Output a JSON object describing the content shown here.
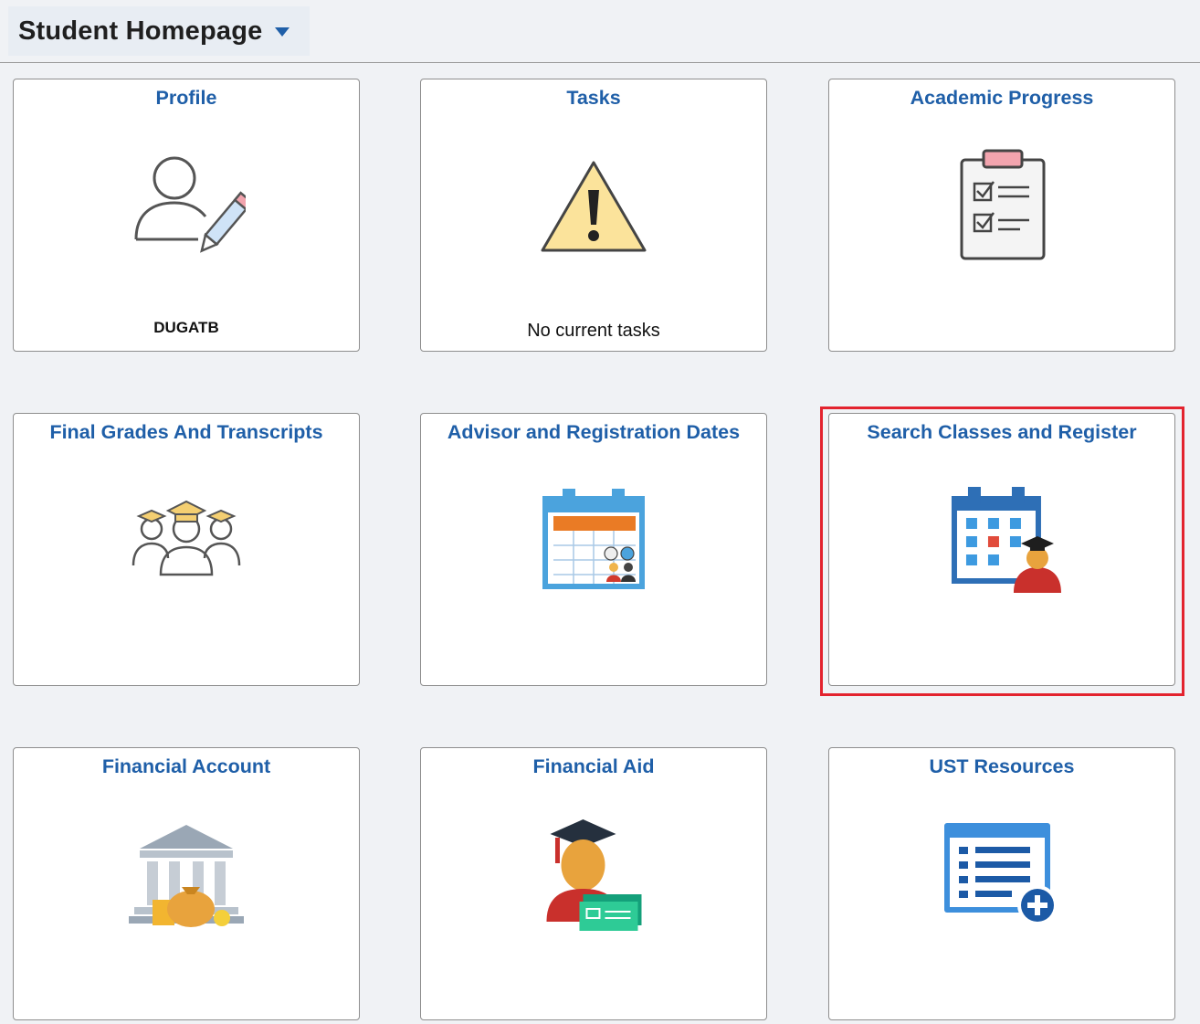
{
  "header": {
    "title": "Student Homepage"
  },
  "tiles": [
    {
      "title": "Profile",
      "subtitle": "DUGATB",
      "icon": "profile-edit-icon"
    },
    {
      "title": "Tasks",
      "subtitle": "No current tasks",
      "icon": "warning-icon"
    },
    {
      "title": "Academic Progress",
      "icon": "clipboard-checklist-icon"
    },
    {
      "title": "Final Grades And Transcripts",
      "icon": "graduates-group-icon"
    },
    {
      "title": "Advisor and Registration Dates",
      "icon": "calendar-advisor-icon"
    },
    {
      "title": "Search Classes and Register",
      "icon": "calendar-student-icon"
    },
    {
      "title": "Financial Account",
      "icon": "bank-money-icon"
    },
    {
      "title": "Financial Aid",
      "icon": "graduate-cash-icon"
    },
    {
      "title": "UST Resources",
      "icon": "list-add-icon"
    }
  ],
  "colors": {
    "tile_title": "#1f5fa8",
    "highlight": "#e3232e"
  }
}
